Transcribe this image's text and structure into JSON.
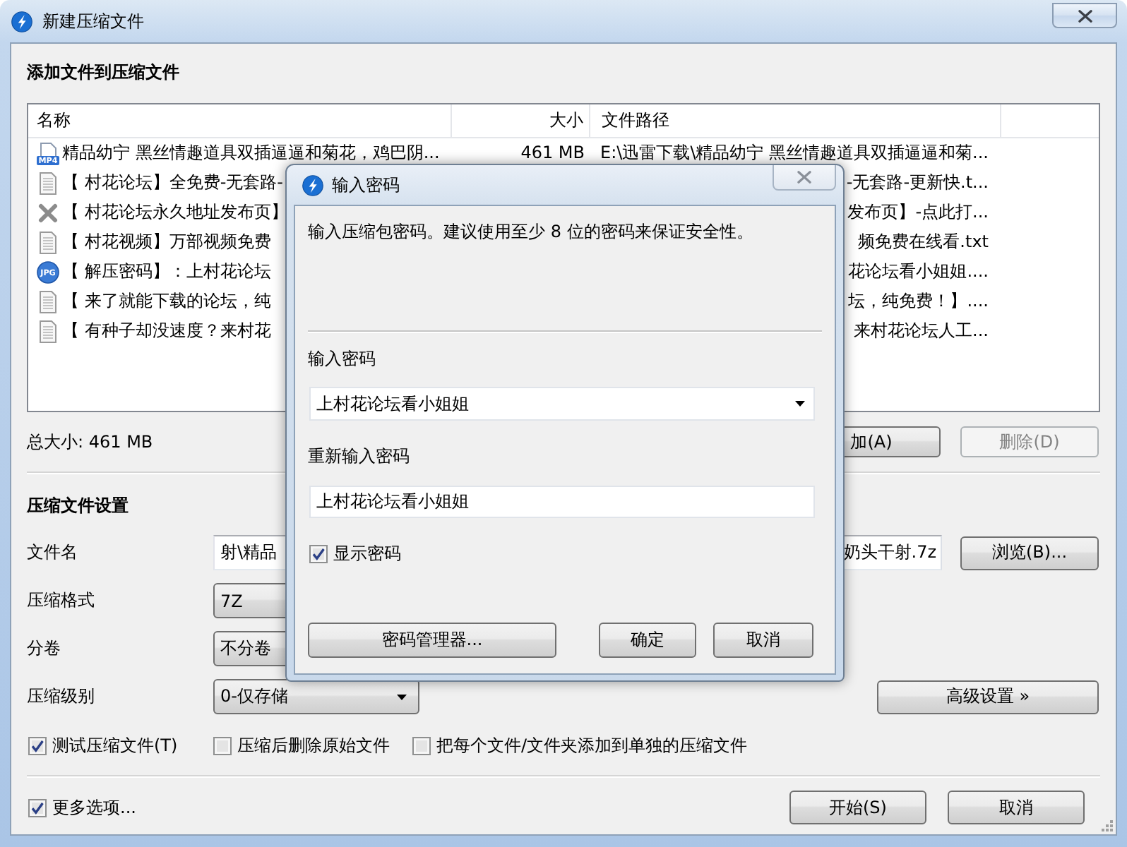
{
  "window": {
    "title": "新建压缩文件"
  },
  "files_section": {
    "heading": "添加文件到压缩文件",
    "columns": [
      "名称",
      "大小",
      "文件路径"
    ],
    "rows": [
      {
        "kind": "video",
        "icon_label": "MP4",
        "name": "精品幼宁 黑丝情趣道具双插逼逼和菊花，鸡巴阴...",
        "size": "461 MB",
        "path": "E:\\迅雷下载\\精品幼宁 黑丝情趣道具双插逼逼和菊..."
      },
      {
        "kind": "text",
        "name": "【 村花论坛】全免费-无套路-",
        "path": "-无套路-更新快.t..."
      },
      {
        "kind": "unknown",
        "name": "【 村花论坛永久地址发布页】",
        "path": "发布页】-点此打..."
      },
      {
        "kind": "text",
        "name": "【 村花视频】万部视频免费",
        "path": "频免费在线看.txt"
      },
      {
        "kind": "image",
        "icon_label": "JPG",
        "name": "【 解压密码】：上村花论坛",
        "path": "花论坛看小姐姐...."
      },
      {
        "kind": "text",
        "name": "【 来了就能下载的论坛，纯",
        "path": "坛，纯免费！】...."
      },
      {
        "kind": "text",
        "name": "【 有种子却没速度？来村花",
        "path": "来村花论坛人工..."
      }
    ],
    "total": "总大小: 461 MB",
    "buttons": [
      {
        "label": "加(A)",
        "disabled": false
      },
      {
        "label": "删除(D)",
        "disabled": true
      }
    ]
  },
  "settings": {
    "heading": "压缩文件设置",
    "fields": [
      {
        "kind": "text",
        "label": "文件名",
        "value_parts": [
          "射\\精品",
          "奶头干射.7z"
        ],
        "button": "浏览(B)..."
      },
      {
        "kind": "select",
        "label": "压缩格式",
        "value": "7Z"
      },
      {
        "kind": "select",
        "label": "分卷",
        "value": "不分卷"
      },
      {
        "kind": "select",
        "label": "压缩级别",
        "value": "0-仅存储",
        "button": "高级设置 »"
      }
    ],
    "options": [
      {
        "label": "测试压缩文件(T)",
        "checked": true
      },
      {
        "label": "压缩后删除原始文件",
        "checked": false
      },
      {
        "label": "把每个文件/文件夹添加到单独的压缩文件",
        "checked": false
      }
    ]
  },
  "footer": {
    "more_options": {
      "label": "更多选项...",
      "checked": true
    },
    "buttons": [
      "开始(S)",
      "取消"
    ]
  },
  "password_dialog": {
    "title": "输入密码",
    "message": "输入压缩包密码。建议使用至少 8 位的密码来保证安全性。",
    "password_label": "输入密码",
    "password": "上村花论坛看小姐姐",
    "confirm_label": "重新输入密码",
    "confirm": "上村花论坛看小姐姐",
    "show_password": {
      "label": "显示密码",
      "checked": true
    },
    "buttons": [
      "密码管理器...",
      "确定",
      "取消"
    ]
  }
}
